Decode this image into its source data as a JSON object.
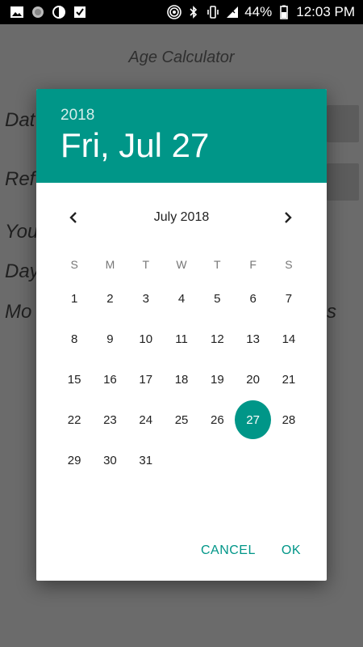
{
  "status_bar": {
    "battery": "44%",
    "time": "12:03 PM"
  },
  "app": {
    "title": "Age Calculator",
    "labels": [
      "Dat",
      "Ref",
      "You",
      "Day",
      "Mo"
    ],
    "tail": "s"
  },
  "dialog": {
    "year": "2018",
    "date": "Fri, Jul 27",
    "month_label": "July 2018",
    "weekdays": [
      "S",
      "M",
      "T",
      "W",
      "T",
      "F",
      "S"
    ],
    "days": [
      [
        "1",
        "2",
        "3",
        "4",
        "5",
        "6",
        "7"
      ],
      [
        "8",
        "9",
        "10",
        "11",
        "12",
        "13",
        "14"
      ],
      [
        "15",
        "16",
        "17",
        "18",
        "19",
        "20",
        "21"
      ],
      [
        "22",
        "23",
        "24",
        "25",
        "26",
        "27",
        "28"
      ],
      [
        "29",
        "30",
        "31",
        "",
        "",
        "",
        ""
      ]
    ],
    "selected_day": "27",
    "cancel_label": "CANCEL",
    "ok_label": "OK"
  },
  "colors": {
    "accent": "#009688"
  }
}
